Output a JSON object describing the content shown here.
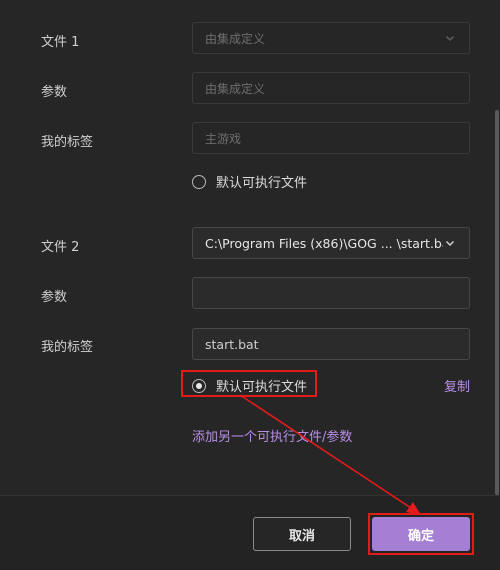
{
  "file1": {
    "label": "文件 1",
    "select_value": "由集成定义",
    "params_label": "参数",
    "params_placeholder": "由集成定义",
    "tag_label": "我的标签",
    "tag_placeholder": "主游戏",
    "default_label": "默认可执行文件",
    "default_checked": false
  },
  "file2": {
    "label": "文件 2",
    "select_value": "C:\\Program Files (x86)\\GOG ... \\start.bat",
    "params_label": "参数",
    "params_value": "",
    "tag_label": "我的标签",
    "tag_value": "start.bat",
    "default_label": "默认可执行文件",
    "default_checked": true,
    "copy_link": "复制"
  },
  "add_link": "添加另一个可执行文件/参数",
  "footer": {
    "cancel_label": "取消",
    "ok_label": "确定"
  },
  "colors": {
    "accent": "#a57fd3",
    "link": "#b98ee6",
    "highlight": "#e31b1b",
    "background": "#262626"
  }
}
